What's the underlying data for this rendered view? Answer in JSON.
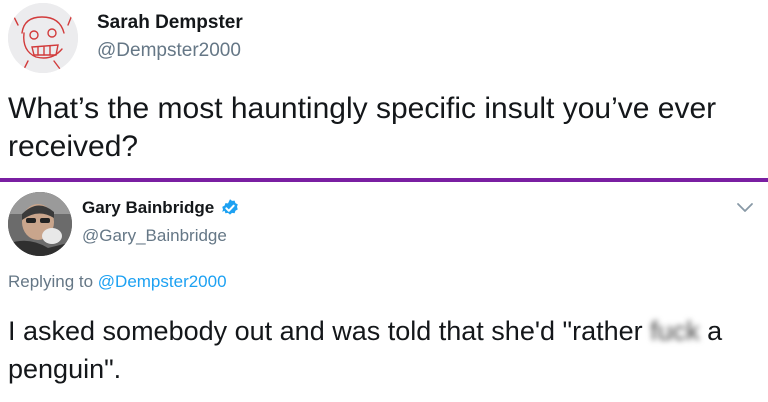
{
  "tweet": {
    "author_name": "Sarah Dempster",
    "author_handle": "@Dempster2000",
    "text": "What’s the most hauntingly specific insult you’ve ever received?"
  },
  "reply": {
    "author_name": "Gary Bainbridge",
    "author_handle": "@Gary_Bainbridge",
    "verified": true,
    "replying_to_prefix": "Replying to",
    "replying_to_handle": "@Dempster2000",
    "text_before": "I asked somebody out and was told that she'd \"rather ",
    "text_censored": "fuck",
    "text_after": " a penguin\"."
  },
  "icons": {
    "verified": "verified-badge-icon",
    "menu": "chevron-down-icon"
  },
  "colors": {
    "divider": "#7a1fa2",
    "link": "#1da1f2",
    "secondary_text": "#657786",
    "verified_blue": "#1da1f2"
  }
}
